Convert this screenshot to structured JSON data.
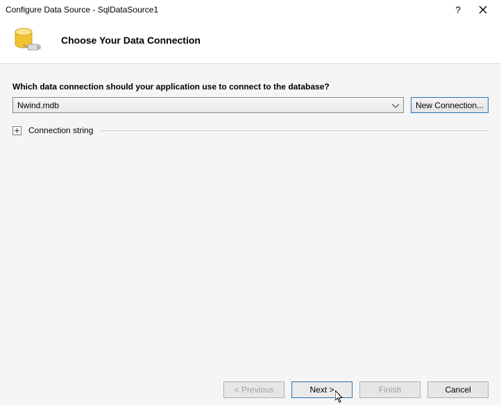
{
  "title": "Configure Data Source - SqlDataSource1",
  "header": {
    "heading": "Choose Your Data Connection"
  },
  "question": "Which data connection should your application use to connect to the database?",
  "connection": {
    "selected": "Nwind.mdb",
    "new_button": "New Connection..."
  },
  "connection_string_label": "Connection string",
  "buttons": {
    "previous": "< Previous",
    "next": "Next >",
    "finish": "Finish",
    "cancel": "Cancel"
  }
}
